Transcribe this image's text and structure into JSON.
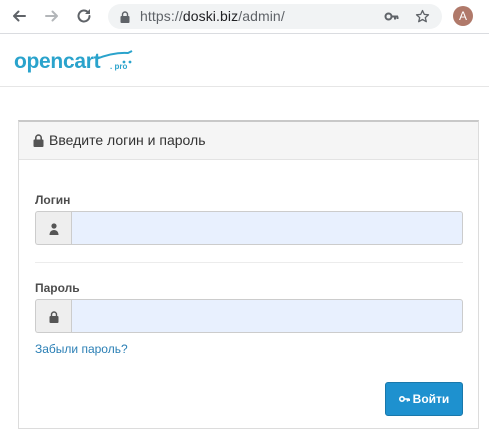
{
  "browser": {
    "url_host": "doski.biz",
    "url_scheme": "https://",
    "url_path": "/admin/",
    "avatar_letter": "A",
    "icons": [
      "back-arrow-icon",
      "forward-arrow-icon",
      "reload-icon",
      "lock-icon",
      "key-icon",
      "star-icon"
    ]
  },
  "site": {
    "logo_text": "opencart",
    "logo_sub": ". pro",
    "brand_color": "#2aa3cc"
  },
  "login": {
    "heading": "Введите логин и пароль",
    "username_label": "Логин",
    "username_value": "",
    "password_label": "Пароль",
    "password_value": "",
    "forgot_link": "Забыли пароль?",
    "submit_label": "Войти",
    "button_color": "#1e91cf"
  }
}
